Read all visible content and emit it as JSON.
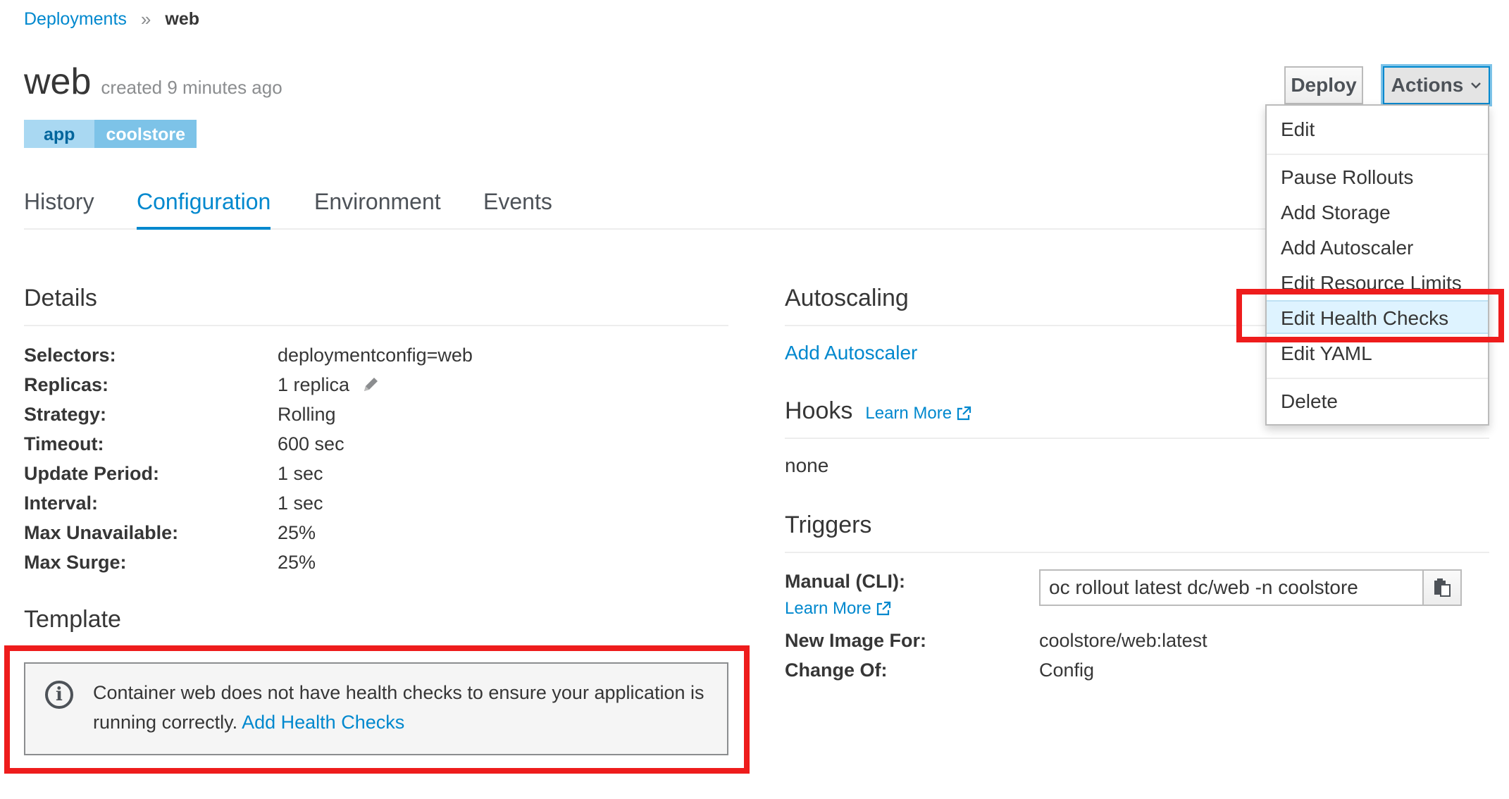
{
  "breadcrumb": {
    "parent": "Deployments",
    "separator": "»",
    "current": "web"
  },
  "header": {
    "name": "web",
    "created": "created 9 minutes ago"
  },
  "labels": [
    {
      "key": "app",
      "value": "coolstore"
    }
  ],
  "tabs": [
    {
      "label": "History",
      "active": false
    },
    {
      "label": "Configuration",
      "active": true
    },
    {
      "label": "Environment",
      "active": false
    },
    {
      "label": "Events",
      "active": false
    }
  ],
  "toolbar": {
    "deploy_label": "Deploy",
    "actions_label": "Actions"
  },
  "actions_menu": {
    "items": [
      "Edit",
      "Pause Rollouts",
      "Add Storage",
      "Add Autoscaler",
      "Edit Resource Limits",
      "Edit Health Checks",
      "Edit YAML",
      "Delete"
    ],
    "selected": "Edit Health Checks"
  },
  "details": {
    "title": "Details",
    "rows": [
      {
        "key": "Selectors:",
        "value": "deploymentconfig=web"
      },
      {
        "key": "Replicas:",
        "value": "1 replica"
      },
      {
        "key": "Strategy:",
        "value": "Rolling"
      },
      {
        "key": "Timeout:",
        "value": "600 sec"
      },
      {
        "key": "Update Period:",
        "value": "1 sec"
      },
      {
        "key": "Interval:",
        "value": "1 sec"
      },
      {
        "key": "Max Unavailable:",
        "value": "25%"
      },
      {
        "key": "Max Surge:",
        "value": "25%"
      }
    ]
  },
  "template": {
    "title": "Template",
    "alert_text": "Container web does not have health checks to ensure your application is running correctly.",
    "alert_link": "Add Health Checks"
  },
  "autoscaling": {
    "title": "Autoscaling",
    "link": "Add Autoscaler"
  },
  "hooks": {
    "title": "Hooks",
    "learn_more": "Learn More",
    "value": "none"
  },
  "triggers": {
    "title": "Triggers",
    "manual_label": "Manual (CLI):",
    "learn_more": "Learn More",
    "cli_command": "oc rollout latest dc/web -n coolstore",
    "new_image_label": "New Image For:",
    "new_image_value": "coolstore/web:latest",
    "change_of_label": "Change Of:",
    "change_of_value": "Config"
  },
  "colors": {
    "accent": "#0088ce",
    "highlight": "#ee1c1c",
    "label_key_bg": "#a9d8f2",
    "label_value_bg": "#7dc3e8"
  }
}
